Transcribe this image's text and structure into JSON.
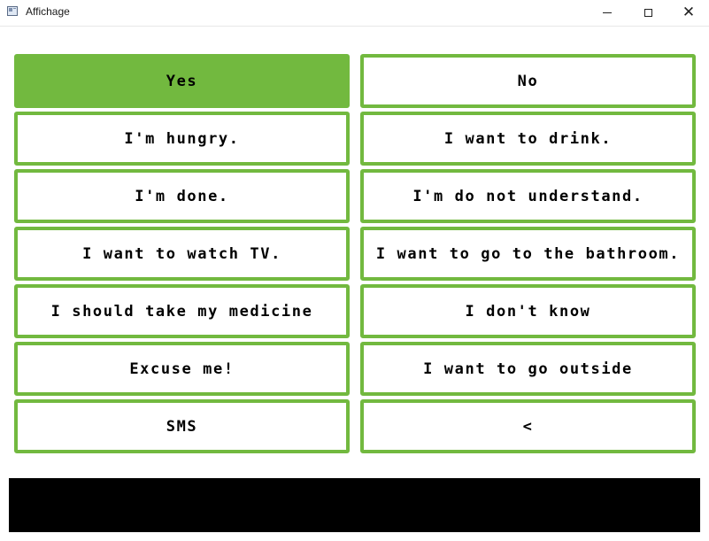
{
  "window": {
    "title": "Affichage"
  },
  "colors": {
    "accent": "#72b93f",
    "output_bar": "#000000"
  },
  "phrases": [
    {
      "label": "Yes",
      "selected": true
    },
    {
      "label": "No",
      "selected": false
    },
    {
      "label": "I'm hungry.",
      "selected": false
    },
    {
      "label": "I want to drink.",
      "selected": false
    },
    {
      "label": "I'm done.",
      "selected": false
    },
    {
      "label": "I'm do not understand.",
      "selected": false
    },
    {
      "label": "I want to watch TV.",
      "selected": false
    },
    {
      "label": "I want to go to the bathroom.",
      "selected": false
    },
    {
      "label": "I should take my medicine",
      "selected": false
    },
    {
      "label": "I don't know",
      "selected": false
    },
    {
      "label": "Excuse me!",
      "selected": false
    },
    {
      "label": "I want to go outside",
      "selected": false
    },
    {
      "label": "SMS",
      "selected": false
    },
    {
      "label": "<",
      "selected": false
    }
  ],
  "output": {
    "text": ""
  }
}
